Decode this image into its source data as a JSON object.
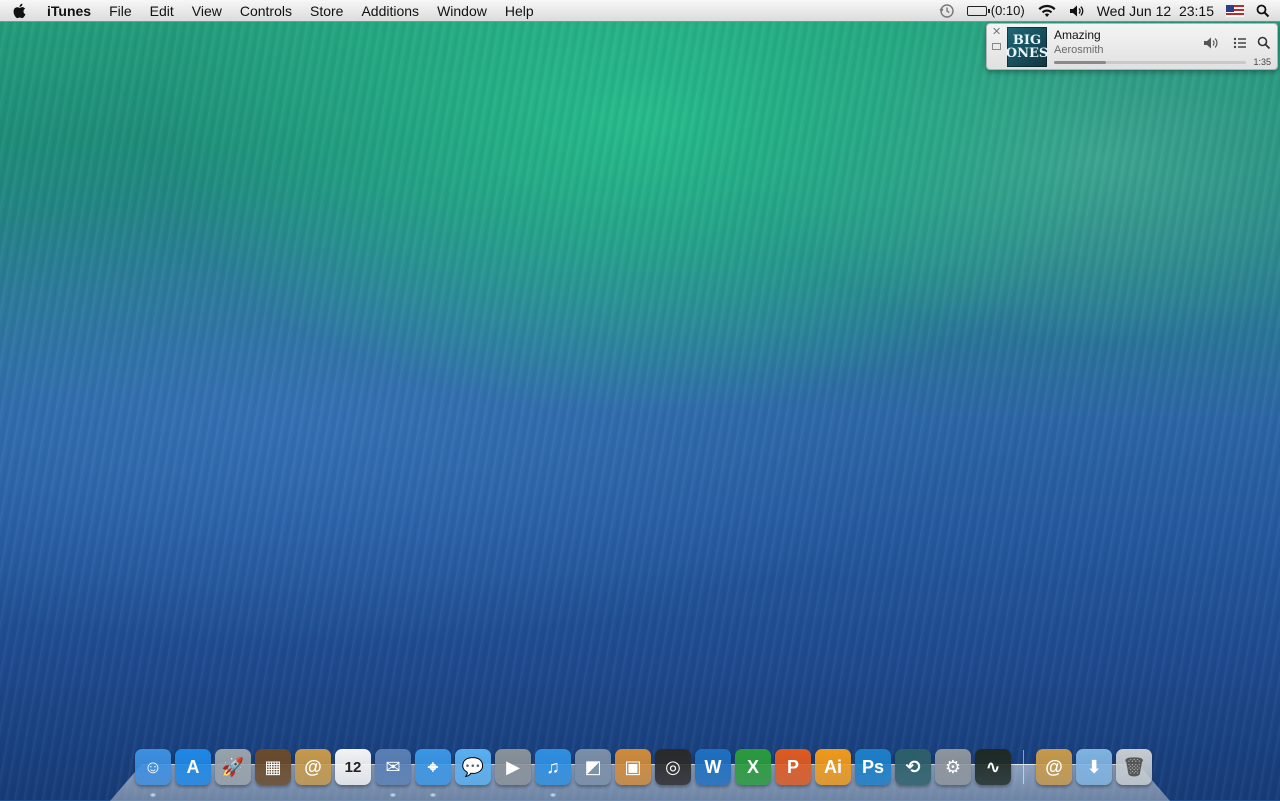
{
  "menubar": {
    "app_name": "iTunes",
    "menus": [
      "File",
      "Edit",
      "View",
      "Controls",
      "Store",
      "Additions",
      "Window",
      "Help"
    ],
    "battery_text": "(0:10)",
    "clock": "Wed Jun 12  23:15",
    "status_icons": [
      "time-machine-icon",
      "battery-icon",
      "wifi-icon",
      "volume-icon",
      "us-flag-icon",
      "spotlight-icon"
    ]
  },
  "miniplayer": {
    "title": "Amazing",
    "artist": "Aerosmith",
    "time": "1:35",
    "progress": 0.27,
    "artwork_text": "BIG ONES"
  },
  "dock": {
    "apps": [
      {
        "name": "finder",
        "icon": "finder-icon",
        "color": "#3d8fe0",
        "glyph": "☺",
        "running": true
      },
      {
        "name": "app-store",
        "icon": "app-store-icon",
        "color": "#1e88e5",
        "glyph": "A",
        "running": false
      },
      {
        "name": "launchpad",
        "icon": "rocket-icon",
        "color": "#9aa3ab",
        "glyph": "🚀",
        "running": false
      },
      {
        "name": "photo-booth",
        "icon": "photo-booth-icon",
        "color": "#6b4a2a",
        "glyph": "▦",
        "running": false
      },
      {
        "name": "contacts",
        "icon": "contacts-icon",
        "color": "#c79a4a",
        "glyph": "@",
        "running": false
      },
      {
        "name": "calendar",
        "icon": "calendar-icon",
        "color": "#f4f4f4",
        "glyph": "12",
        "running": false
      },
      {
        "name": "mail-stamp",
        "icon": "stamp-icon",
        "color": "#5a7fb5",
        "glyph": "✉",
        "running": true
      },
      {
        "name": "safari",
        "icon": "safari-icon",
        "color": "#3a96e4",
        "glyph": "⌖",
        "running": true
      },
      {
        "name": "messages",
        "icon": "messages-icon",
        "color": "#5ab0f0",
        "glyph": "💬",
        "running": false
      },
      {
        "name": "facetime",
        "icon": "facetime-icon",
        "color": "#8a9299",
        "glyph": "▶",
        "running": false
      },
      {
        "name": "itunes",
        "icon": "itunes-icon",
        "color": "#2f8fe0",
        "glyph": "♫",
        "running": true
      },
      {
        "name": "preview",
        "icon": "preview-icon",
        "color": "#7c8fa8",
        "glyph": "◩",
        "running": false
      },
      {
        "name": "iphoto",
        "icon": "iphoto-icon",
        "color": "#d08b3a",
        "glyph": "▣",
        "running": false
      },
      {
        "name": "aperture",
        "icon": "aperture-icon",
        "color": "#2a2a2a",
        "glyph": "◎",
        "running": false
      },
      {
        "name": "word",
        "icon": "word-icon",
        "color": "#1f6fc0",
        "glyph": "W",
        "running": false
      },
      {
        "name": "excel",
        "icon": "excel-icon",
        "color": "#2b9b3c",
        "glyph": "X",
        "running": false
      },
      {
        "name": "powerpoint",
        "icon": "powerpoint-icon",
        "color": "#e05a20",
        "glyph": "P",
        "running": false
      },
      {
        "name": "illustrator",
        "icon": "illustrator-icon",
        "color": "#f19a1b",
        "glyph": "Ai",
        "running": false
      },
      {
        "name": "photoshop",
        "icon": "photoshop-icon",
        "color": "#1c7fc8",
        "glyph": "Ps",
        "running": false
      },
      {
        "name": "time-machine",
        "icon": "time-machine-icon",
        "color": "#2d5f6a",
        "glyph": "⟲",
        "running": false
      },
      {
        "name": "system-preferences",
        "icon": "gear-icon",
        "color": "#8e959c",
        "glyph": "⚙",
        "running": false
      },
      {
        "name": "activity-monitor",
        "icon": "activity-monitor-icon",
        "color": "#1f2a25",
        "glyph": "∿",
        "running": false
      }
    ],
    "stacks": [
      {
        "name": "contacts-stack",
        "icon": "address-book-icon",
        "color": "#c79a4a",
        "glyph": "@"
      },
      {
        "name": "downloads-folder",
        "icon": "folder-icon",
        "color": "#7fb3e0",
        "glyph": "⬇"
      },
      {
        "name": "trash",
        "icon": "trash-icon",
        "color": "#c7ccd1",
        "glyph": "🗑"
      }
    ]
  }
}
